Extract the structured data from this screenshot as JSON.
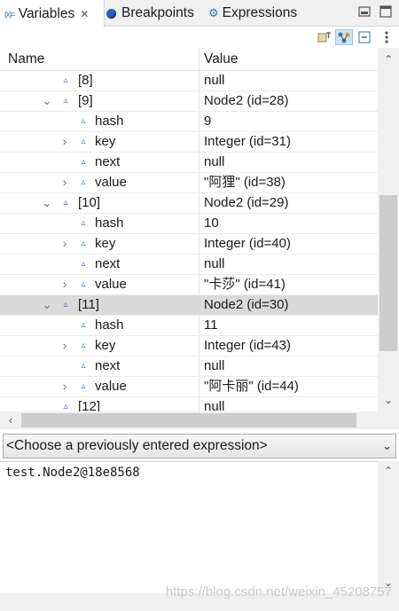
{
  "tabs": [
    {
      "label": "Variables",
      "icon": "variables-icon",
      "active": true
    },
    {
      "label": "Breakpoints",
      "icon": "breakpoints-icon",
      "active": false
    },
    {
      "label": "Expressions",
      "icon": "expressions-icon",
      "active": false
    }
  ],
  "tab_icon_text": "(x)=",
  "table": {
    "col_name": "Name",
    "col_value": "Value",
    "rows": [
      {
        "name": "[8]",
        "value": "null",
        "level": 1,
        "expand": "none"
      },
      {
        "name": "[9]",
        "value": "Node2  (id=28)",
        "level": 1,
        "expand": "open"
      },
      {
        "name": "hash",
        "value": "9",
        "level": 2,
        "expand": "none"
      },
      {
        "name": "key",
        "value": "Integer  (id=31)",
        "level": 2,
        "expand": "closed"
      },
      {
        "name": "next",
        "value": "null",
        "level": 2,
        "expand": "none"
      },
      {
        "name": "value",
        "value": "\"阿狸\" (id=38)",
        "level": 2,
        "expand": "closed"
      },
      {
        "name": "[10]",
        "value": "Node2  (id=29)",
        "level": 1,
        "expand": "open"
      },
      {
        "name": "hash",
        "value": "10",
        "level": 2,
        "expand": "none"
      },
      {
        "name": "key",
        "value": "Integer  (id=40)",
        "level": 2,
        "expand": "closed"
      },
      {
        "name": "next",
        "value": "null",
        "level": 2,
        "expand": "none"
      },
      {
        "name": "value",
        "value": "\"卡莎\" (id=41)",
        "level": 2,
        "expand": "closed"
      },
      {
        "name": "[11]",
        "value": "Node2  (id=30)",
        "level": 1,
        "expand": "open",
        "selected": true
      },
      {
        "name": "hash",
        "value": "11",
        "level": 2,
        "expand": "none"
      },
      {
        "name": "key",
        "value": "Integer  (id=43)",
        "level": 2,
        "expand": "closed"
      },
      {
        "name": "next",
        "value": "null",
        "level": 2,
        "expand": "none"
      },
      {
        "name": "value",
        "value": "\"阿卡丽\" (id=44)",
        "level": 2,
        "expand": "closed"
      },
      {
        "name": "[12]",
        "value": "null",
        "level": 1,
        "expand": "none"
      }
    ]
  },
  "expression_combo": {
    "placeholder": "<Choose a previously entered expression>"
  },
  "detail": {
    "text": "test.Node2@18e8568"
  },
  "watermark": "https://blog.csdn.net/weixin_45208757",
  "colors": {
    "accent": "#3b7bc4",
    "selected_row": "#dadada",
    "toolbar_pressed": "#cde3f7"
  }
}
